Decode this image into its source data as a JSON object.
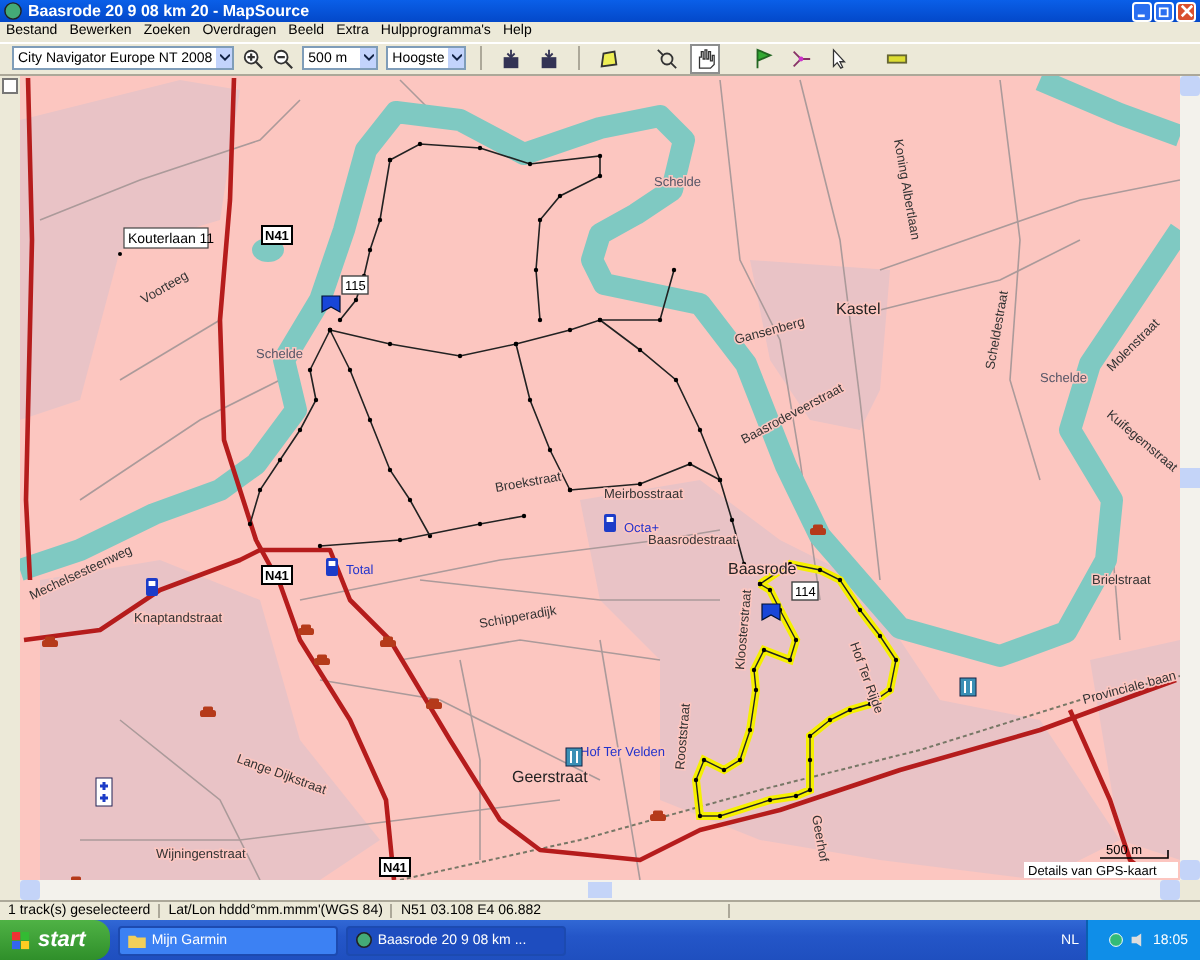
{
  "window": {
    "title": "Baasrode 20 9 08 km 20 - MapSource"
  },
  "menu": [
    "Bestand",
    "Bewerken",
    "Zoeken",
    "Overdragen",
    "Beeld",
    "Extra",
    "Hulpprogramma's",
    "Help"
  ],
  "toolbar": {
    "map_product": "City Navigator Europe NT 2008",
    "zoom_scale": "500 m",
    "detail": "Hoogste",
    "tools": [
      {
        "kind": "transfer",
        "selected": false
      },
      {
        "kind": "transfer",
        "selected": false
      },
      {
        "kind": "map",
        "selected": false
      },
      {
        "kind": "zoom",
        "selected": false
      },
      {
        "kind": "hand",
        "selected": true
      },
      {
        "kind": "flag",
        "selected": false
      },
      {
        "kind": "route",
        "selected": false
      },
      {
        "kind": "pointer",
        "selected": false
      },
      {
        "kind": "measure",
        "selected": false
      }
    ]
  },
  "map": {
    "callout": "Kouterlaan 11",
    "road_shields": [
      "N41",
      "N41",
      "N41"
    ],
    "route_markers": [
      "115",
      "114"
    ],
    "labels": [
      {
        "text": "Voorteeg",
        "kind": "street"
      },
      {
        "text": "Schelde",
        "kind": "water"
      },
      {
        "text": "Schelde",
        "kind": "water"
      },
      {
        "text": "Schelde",
        "kind": "water"
      },
      {
        "text": "Kastel",
        "kind": "place"
      },
      {
        "text": "Gansenberg",
        "kind": "street"
      },
      {
        "text": "Baasrodeveerstraat",
        "kind": "street"
      },
      {
        "text": "Koning Albertlaan",
        "kind": "street"
      },
      {
        "text": "Scheldestraat",
        "kind": "street"
      },
      {
        "text": "Molenstraat",
        "kind": "street"
      },
      {
        "text": "Kuifegemstraat",
        "kind": "street"
      },
      {
        "text": "Broekstraat",
        "kind": "street"
      },
      {
        "text": "Meirbosstraat",
        "kind": "street"
      },
      {
        "text": "Baasrodestraat",
        "kind": "street"
      },
      {
        "text": "Baasrode",
        "kind": "place"
      },
      {
        "text": "Knaptandstraat",
        "kind": "street"
      },
      {
        "text": "Mechelsesteenweg",
        "kind": "street"
      },
      {
        "text": "Total",
        "kind": "poi"
      },
      {
        "text": "Octa+",
        "kind": "poi"
      },
      {
        "text": "Schipperadijk",
        "kind": "street"
      },
      {
        "text": "Geerstraat",
        "kind": "place"
      },
      {
        "text": "Hof Ter Velden",
        "kind": "poi"
      },
      {
        "text": "Lange Dijkstraat",
        "kind": "street"
      },
      {
        "text": "Kloosterstraat",
        "kind": "street"
      },
      {
        "text": "Hof Ter Rijde",
        "kind": "street"
      },
      {
        "text": "Rooststraat",
        "kind": "street"
      },
      {
        "text": "Geerhof",
        "kind": "street"
      },
      {
        "text": "Provinciale baan",
        "kind": "street"
      },
      {
        "text": "Brielstraat",
        "kind": "street"
      },
      {
        "text": "Wijningenstraat",
        "kind": "street"
      }
    ],
    "scale": "500 m",
    "overlay_note": "Details van GPS-kaart"
  },
  "status_bar": [
    "1 track(s) geselecteerd",
    "Lat/Lon hddd°mm.mmm'(WGS 84)",
    "N51 03.108 E4 06.882"
  ],
  "taskbar": {
    "start": "start",
    "tasks": [
      {
        "label": "Mijn Garmin",
        "selected": false
      },
      {
        "label": "Baasrode 20 9 08 km ...",
        "selected": true
      }
    ],
    "language": "NL",
    "clock": "18:05"
  }
}
